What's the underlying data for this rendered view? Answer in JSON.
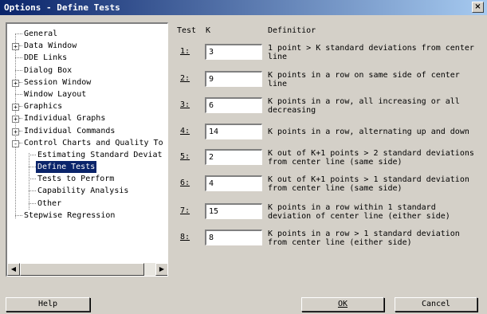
{
  "window": {
    "title": "Options - Define Tests",
    "close_glyph": "×"
  },
  "tree": {
    "items": [
      {
        "label": "General",
        "expander": ""
      },
      {
        "label": "Data Window",
        "expander": "+"
      },
      {
        "label": "DDE Links",
        "expander": ""
      },
      {
        "label": "Dialog Box",
        "expander": ""
      },
      {
        "label": "Session Window",
        "expander": "+"
      },
      {
        "label": "Window Layout",
        "expander": ""
      },
      {
        "label": "Graphics",
        "expander": "+"
      },
      {
        "label": "Individual Graphs",
        "expander": "+"
      },
      {
        "label": "Individual Commands",
        "expander": "+"
      },
      {
        "label": "Control Charts and Quality To",
        "expander": "-"
      },
      {
        "label": "Estimating Standard Deviat",
        "expander": ""
      },
      {
        "label": "Define Tests",
        "expander": "",
        "selected": true
      },
      {
        "label": "Tests to Perform",
        "expander": ""
      },
      {
        "label": "Capability Analysis",
        "expander": ""
      },
      {
        "label": "Other",
        "expander": ""
      },
      {
        "label": "Stepwise Regression",
        "expander": ""
      }
    ],
    "scroll_left_glyph": "◀",
    "scroll_right_glyph": "▶"
  },
  "headers": {
    "test": "Test",
    "k": "K",
    "definition": "Definitior"
  },
  "tests": [
    {
      "num": "1",
      "k": "3",
      "def1": "1 point > K standard deviations from center",
      "def2": "line"
    },
    {
      "num": "2",
      "k": "9",
      "def1": "K points in a row on same side of center",
      "def2": "line"
    },
    {
      "num": "3",
      "k": "6",
      "def1": "K points in a row, all increasing or all",
      "def2": "decreasing"
    },
    {
      "num": "4",
      "k": "14",
      "def1": "K points in a row, alternating up and down",
      "def2": ""
    },
    {
      "num": "5",
      "k": "2",
      "def1": "K out of K+1 points > 2 standard deviations",
      "def2": "from center line (same side)"
    },
    {
      "num": "6",
      "k": "4",
      "def1": "K out of K+1 points > 1 standard deviation",
      "def2": "from center line (same side)"
    },
    {
      "num": "7",
      "k": "15",
      "def1": "K points in a row within 1 standard",
      "def2": "deviation of center line (either side)"
    },
    {
      "num": "8",
      "k": "8",
      "def1": "K points in a row > 1 standard deviation",
      "def2": "from center line (either side)"
    }
  ],
  "buttons": {
    "help": "Help",
    "ok": "OK",
    "cancel": "Cancel"
  },
  "colors": {
    "title_start": "#0a246a",
    "title_end": "#a6caf0",
    "face": "#d4d0c8",
    "selection": "#0a246a"
  }
}
